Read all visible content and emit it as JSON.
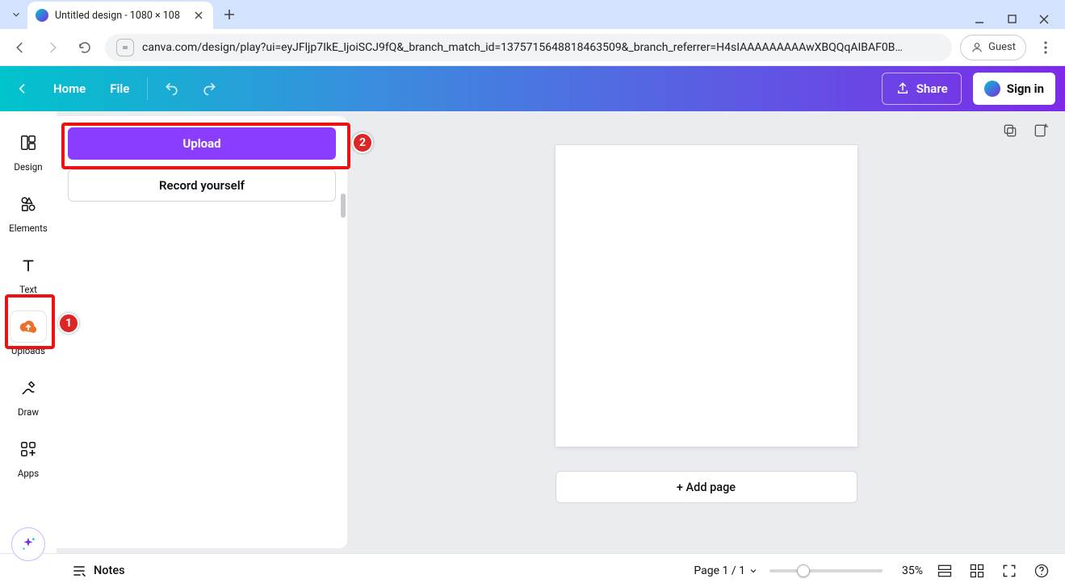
{
  "browser": {
    "tab_title": "Untitled design - 1080 × 108",
    "url": "canva.com/design/play?ui=eyJFljp7IkE_IjoiSCJ9fQ&_branch_match_id=1375715648818463509&_branch_referrer=H4sIAAAAAAAAAwXBQQqAIBAF0B…",
    "guest_label": "Guest"
  },
  "header": {
    "home": "Home",
    "file": "File",
    "share": "Share",
    "signin": "Sign in"
  },
  "rail": {
    "design": "Design",
    "elements": "Elements",
    "text": "Text",
    "uploads": "Uploads",
    "draw": "Draw",
    "apps": "Apps"
  },
  "panel": {
    "upload_btn": "Upload",
    "record_btn": "Record yourself"
  },
  "canvas": {
    "add_page": "+ Add page"
  },
  "footer": {
    "notes": "Notes",
    "page_indicator": "Page 1 / 1",
    "zoom_pct": "35%"
  },
  "callouts": {
    "one": "1",
    "two": "2"
  }
}
